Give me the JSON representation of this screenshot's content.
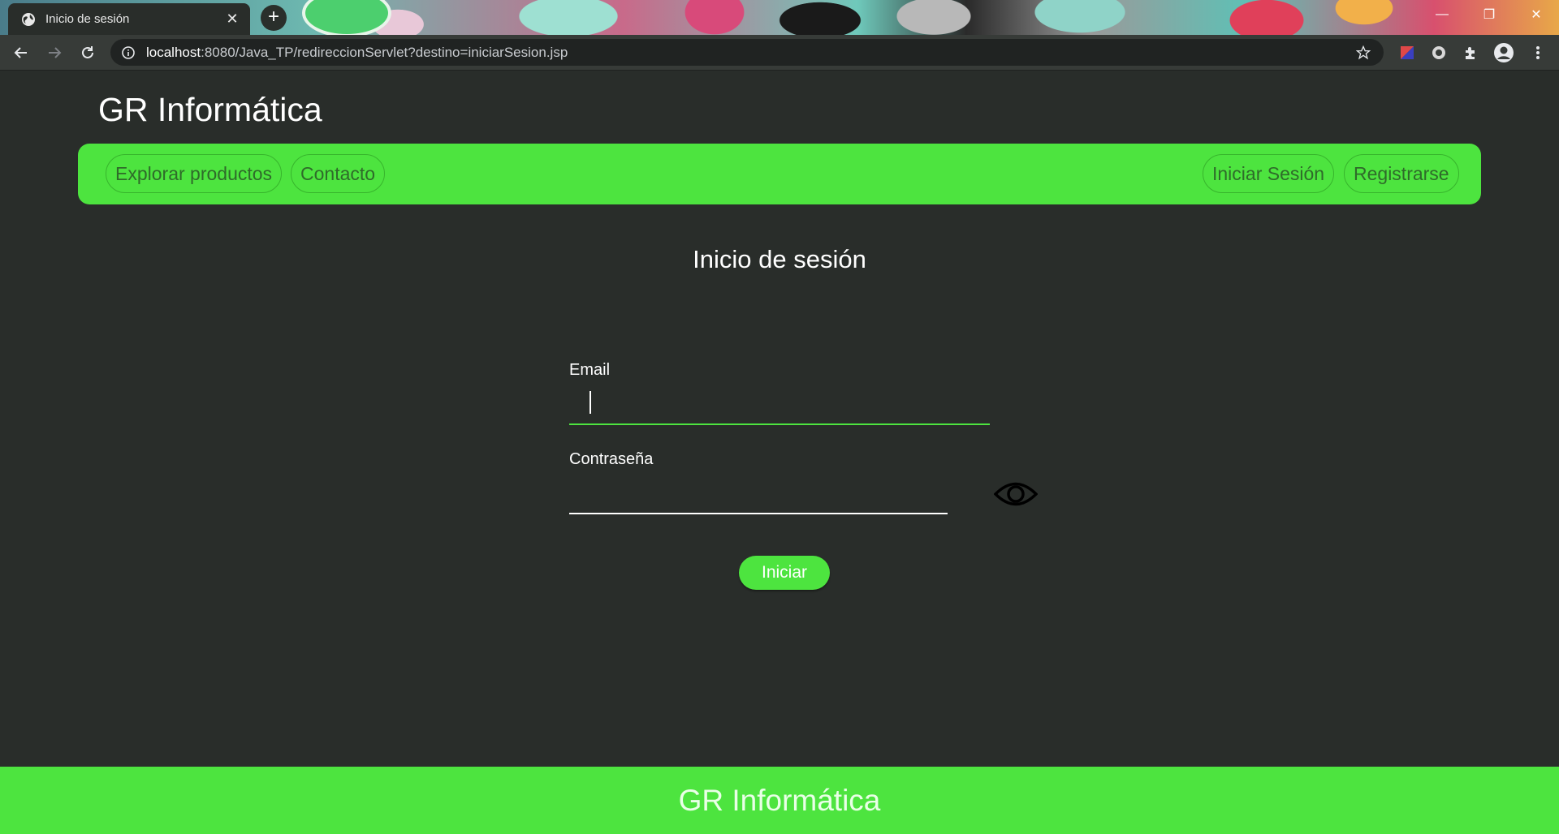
{
  "browser": {
    "tab_title": "Inicio de sesión",
    "tab_close": "✕",
    "new_tab": "+",
    "url_host": "localhost",
    "url_rest": ":8080/Java_TP/redireccionServlet?destino=iniciarSesion.jsp",
    "window_controls": {
      "minimize": "—",
      "restore": "❐",
      "close": "✕"
    },
    "icons": [
      "back-icon",
      "forward-icon",
      "reload-icon",
      "info-icon",
      "star-icon",
      "extension-icon",
      "profile-icon",
      "menu-icon"
    ]
  },
  "site": {
    "brand": "GR Informática",
    "nav_left": [
      "Explorar productos",
      "Contacto"
    ],
    "nav_right": [
      "Iniciar Sesión",
      "Registrarse"
    ]
  },
  "form": {
    "heading": "Inicio de sesión",
    "email_label": "Email",
    "email_value": "",
    "password_label": "Contraseña",
    "password_value": "",
    "submit_label": "Iniciar"
  },
  "footer": {
    "text": "GR Informática"
  },
  "colors": {
    "accent": "#4de43f",
    "background": "#292d2a",
    "chrome": "#373b38"
  }
}
